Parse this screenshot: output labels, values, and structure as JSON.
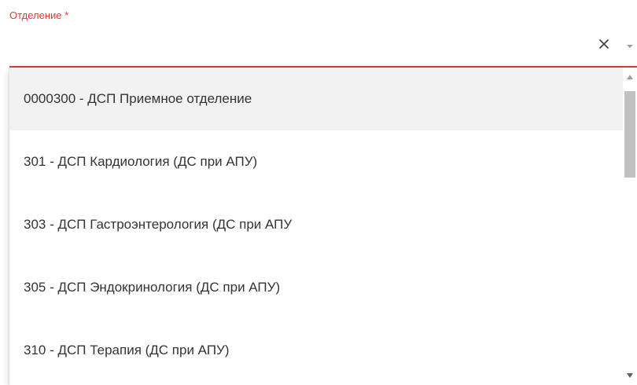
{
  "field": {
    "label": "Отделение *",
    "value": "",
    "clear_icon": "close-icon",
    "dropdown_icon": "caret-down-icon",
    "accent_color": "#e53935"
  },
  "dropdown": {
    "options": [
      {
        "label": "0000300 - ДСП Приемное отделение",
        "highlighted": true
      },
      {
        "label": "301 - ДСП Кардиология (ДС при АПУ)",
        "highlighted": false
      },
      {
        "label": "303 - ДСП Гастроэнтерология (ДС при АПУ",
        "highlighted": false
      },
      {
        "label": "305 - ДСП Эндокринология (ДС при АПУ)",
        "highlighted": false
      },
      {
        "label": "310 - ДСП Терапия (ДС при АПУ)",
        "highlighted": false
      }
    ],
    "highlight_color": "#f2f2f2"
  }
}
